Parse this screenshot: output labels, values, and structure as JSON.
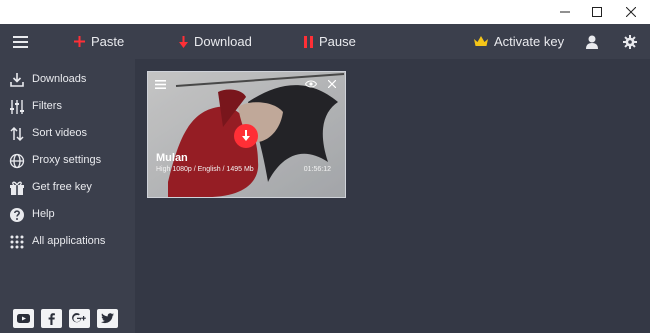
{
  "toolbar": {
    "paste_label": "Paste",
    "download_label": "Download",
    "pause_label": "Pause",
    "activate_label": "Activate key",
    "icons": {
      "menu": "hamburger-icon",
      "paste": "plus-icon",
      "download": "arrow-down-icon",
      "pause": "pause-icon",
      "activate": "crown-icon",
      "user": "user-icon",
      "settings": "gear-icon"
    }
  },
  "sidebar": {
    "items": [
      {
        "label": "Downloads",
        "icon": "download-tray-icon"
      },
      {
        "label": "Filters",
        "icon": "sliders-icon"
      },
      {
        "label": "Sort videos",
        "icon": "sort-icon"
      },
      {
        "label": "Proxy settings",
        "icon": "globe-icon"
      },
      {
        "label": "Get free key",
        "icon": "gift-icon"
      },
      {
        "label": "Help",
        "icon": "help-icon"
      },
      {
        "label": "All applications",
        "icon": "grid-icon"
      }
    ],
    "social": [
      "youtube-icon",
      "facebook-icon",
      "google-plus-icon",
      "twitter-icon"
    ]
  },
  "video_card": {
    "title": "Mulan",
    "meta": "High 1080p / English / 1495 Mb",
    "duration": "01:56:12"
  },
  "colors": {
    "toolbar_bg": "#3b3f4c",
    "main_bg": "#343845",
    "accent_red": "#ff2f36",
    "gold": "#f5c518"
  }
}
